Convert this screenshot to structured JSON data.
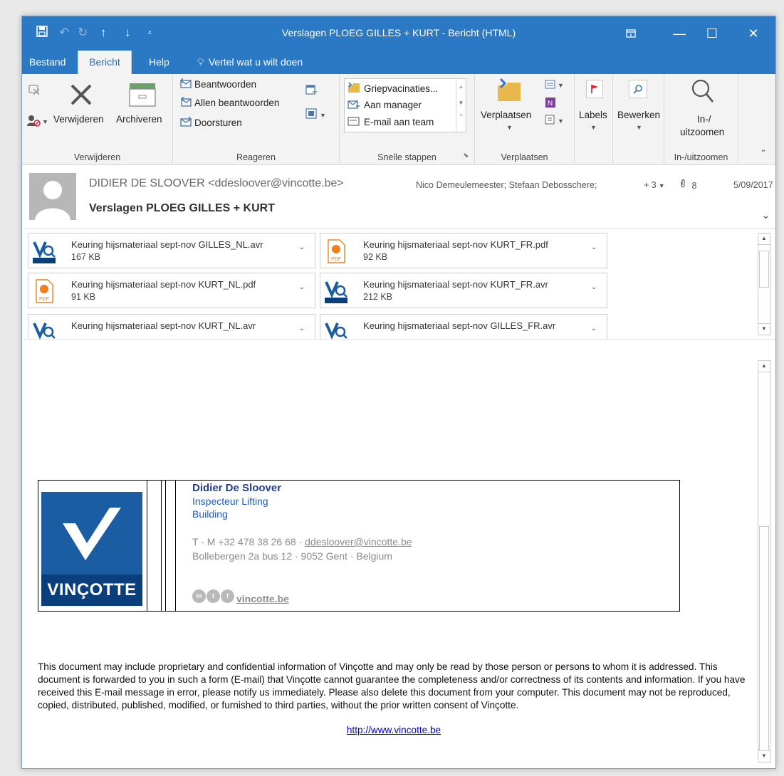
{
  "window": {
    "title": "Verslagen PLOEG GILLES + KURT  -  Bericht (HTML)"
  },
  "tabs": [
    {
      "label": "Bestand"
    },
    {
      "label": "Bericht"
    },
    {
      "label": "Help"
    },
    {
      "label": "Vertel wat u wilt doen"
    }
  ],
  "ribbon": {
    "groups": {
      "delete": {
        "label": "Verwijderen",
        "delete_button": "Verwijderen",
        "archive_button": "Archiveren"
      },
      "respond": {
        "label": "Reageren",
        "reply": "Beantwoorden",
        "reply_all": "Allen beantwoorden",
        "forward": "Doorsturen"
      },
      "quicksteps": {
        "label": "Snelle stappen",
        "items": [
          "Griepvacinaties...",
          "Aan manager",
          "E-mail aan team"
        ]
      },
      "move": {
        "label": "Verplaatsen",
        "move_button": "Verplaatsen"
      },
      "tags": {
        "labels_button": "Labels"
      },
      "editing": {
        "edit_button": "Bewerken"
      },
      "zoom": {
        "label": "In-/uitzoomen",
        "zoom_button_line1": "In-/",
        "zoom_button_line2": "uitzoomen"
      }
    }
  },
  "message": {
    "sender": "DIDIER DE SLOOVER <ddesloover@vincotte.be>",
    "subject": "Verslagen PLOEG GILLES + KURT",
    "recipients": "Nico Demeulemeester; Stefaan Debosschere;",
    "more_recipients": "+ 3",
    "attachment_count": "8",
    "date": "5/09/2017"
  },
  "attachments": [
    {
      "name": "Keuring hijsmateriaal sept-nov GILLES_NL.avr",
      "size": "167 KB",
      "type": "avr"
    },
    {
      "name": "Keuring hijsmateriaal sept-nov KURT_FR.pdf",
      "size": "92 KB",
      "type": "pdf"
    },
    {
      "name": "Keuring hijsmateriaal sept-nov KURT_NL.pdf",
      "size": "91 KB",
      "type": "pdf"
    },
    {
      "name": "Keuring hijsmateriaal sept-nov KURT_FR.avr",
      "size": "212 KB",
      "type": "avr"
    },
    {
      "name": "Keuring hijsmateriaal sept-nov KURT_NL.avr",
      "size": "",
      "type": "avr"
    },
    {
      "name": "Keuring hijsmateriaal sept-nov GILLES_FR.avr",
      "size": "",
      "type": "avr"
    }
  ],
  "signature": {
    "logo_text": "VINÇOTTE",
    "name": "Didier De Sloover",
    "title": "Inspecteur Lifting",
    "department": "Building",
    "contact_prefix": "T · M +32 478 38 26 68 · ",
    "email": "ddesloover@vincotte.be",
    "address": "Bollebergen 2a bus 12 · 9052 Gent · Belgium",
    "social": [
      "in",
      "t",
      "f"
    ],
    "website": "vincotte.be"
  },
  "disclaimer": {
    "text": "This document may include proprietary and confidential information of Vinçotte and may only be read by those person or persons to whom it is addressed. This document is forwarded to you in such a form (E-mail) that Vinçotte cannot guarantee the completeness and/or correctness of its contents and information. If you have received this E-mail message in error, please notify us immediately. Please also delete this document from your computer. This document may not be reproduced, copied, distributed, published, modified, or furnished to third parties, without the prior written consent of Vinçotte.",
    "link": "http://www.vincotte.be"
  },
  "colors": {
    "accent": "#2b79c4",
    "brand_blue": "#1a5da3",
    "brand_dark": "#0b3f7b",
    "pdf_orange": "#f0801e"
  }
}
